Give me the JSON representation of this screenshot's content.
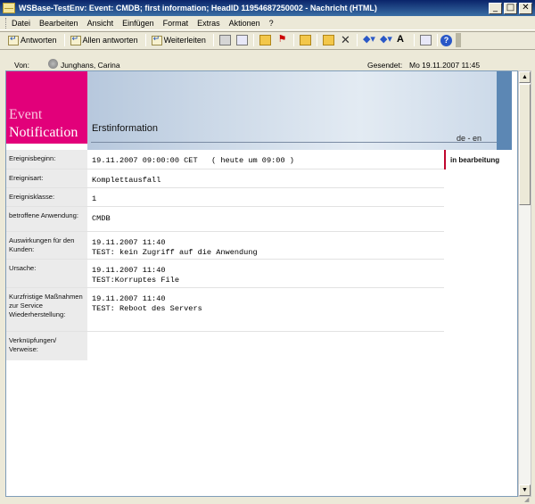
{
  "window": {
    "title": "WSBase-TestEnv: Event: CMDB; first information; HeadID 11954687250002 - Nachricht (HTML)",
    "minimize": "_",
    "maximize": "□",
    "close": "✕"
  },
  "menu": {
    "items": [
      "Datei",
      "Bearbeiten",
      "Ansicht",
      "Einfügen",
      "Format",
      "Extras",
      "Aktionen",
      "?"
    ]
  },
  "toolbar": {
    "reply": "Antworten",
    "reply_all": "Allen antworten",
    "forward": "Weiterleiten"
  },
  "header": {
    "from_label": "Von:",
    "from_value": "Junghans, Carina",
    "sent_label": "Gesendet:",
    "sent_value": "Mo 19.11.2007 11:45"
  },
  "banner": {
    "logo_line1": "Event",
    "logo_line2": "Notification",
    "title": "Erstinformation",
    "language": "de - en"
  },
  "status": "in bearbeitung",
  "rows": [
    {
      "label": "Ereignisbeginn:",
      "value": "19.11.2007 09:00:00 CET   ( heute um 09:00 )"
    },
    {
      "label": "Ereignisart:",
      "value": "Komplettausfall"
    },
    {
      "label": "Ereignisklasse:",
      "value": "1"
    },
    {
      "label": "betroffene Anwendung:",
      "value": "CMDB"
    },
    {
      "label": "Auswirkungen für den Kunden:",
      "value": "19.11.2007 11:40\nTEST: kein Zugriff auf die Anwendung"
    },
    {
      "label": "Ursache:",
      "value": "19.11.2007 11:40\nTEST:Korruptes File"
    },
    {
      "label": "Kurzfristige Maßnahmen zur Service Wiederherstellung:",
      "value": "19.11.2007 11:40\nTEST: Reboot des Servers"
    },
    {
      "label": "Verknüpfungen/ Verweise:",
      "value": ""
    }
  ]
}
